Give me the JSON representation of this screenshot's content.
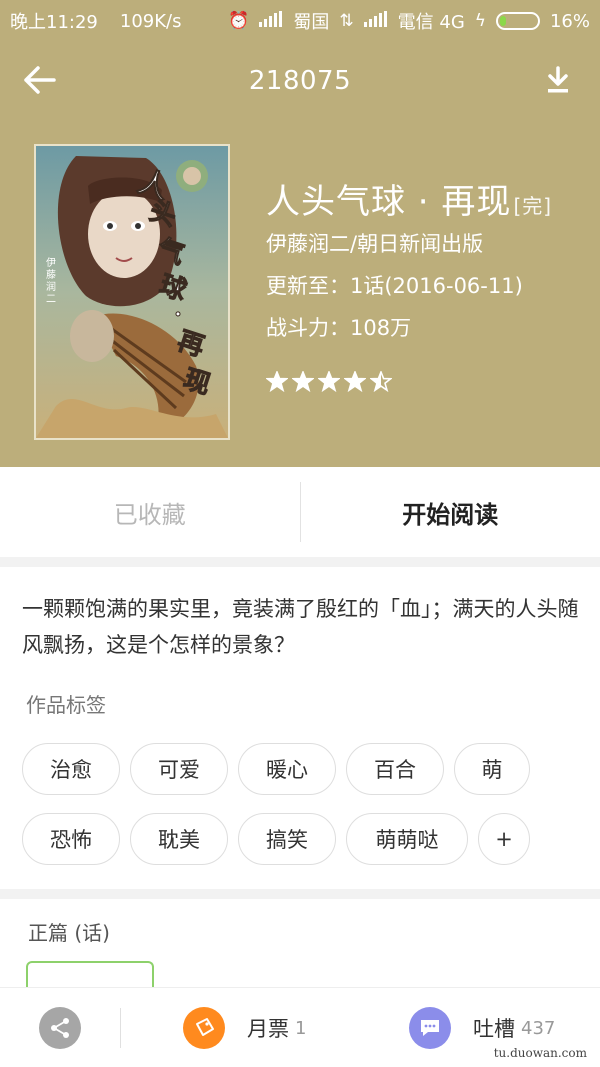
{
  "status_bar": {
    "time": "晚上11:29",
    "speed": "109K/s",
    "carrier1": "蜀国",
    "carrier2": "電信 4G",
    "battery_text": "16%",
    "battery_level": 0.16
  },
  "appbar": {
    "title": "218075",
    "back_icon": "arrow-left-icon",
    "download_icon": "download-icon"
  },
  "book": {
    "title": "人头气球 · 再现",
    "status": "[完]",
    "publisher": "伊藤润二/朝日新闻出版",
    "update": "更新至：1话(2016-06-11)",
    "power": "战斗力：108万",
    "rating": 4.5,
    "cover_lettering": "人头气球·再现"
  },
  "actions": {
    "collected": "已收藏",
    "start_reading": "开始阅读"
  },
  "description": "一颗颗饱满的果实里，竟装满了殷红的「血」；满天的人头随风飘扬，这是个怎样的景象？",
  "tags_title": "作品标签",
  "tags": [
    "治愈",
    "可爱",
    "暖心",
    "百合",
    "萌",
    "恐怖",
    "耽美",
    "搞笑",
    "萌萌哒",
    "+"
  ],
  "chapters": {
    "title": "正篇 (话)"
  },
  "bottom_bar": {
    "share_icon": "share-icon",
    "monthly_vote_label": "月票",
    "monthly_vote_count": "1",
    "comment_label": "吐槽",
    "comment_count": "437"
  },
  "watermark": "tu.duowan.com",
  "colors": {
    "header_bg": "#bcae7b",
    "accent_green": "#8dd16b",
    "vote_orange": "#ff8a1e",
    "comment_purple": "#8b8dea"
  }
}
